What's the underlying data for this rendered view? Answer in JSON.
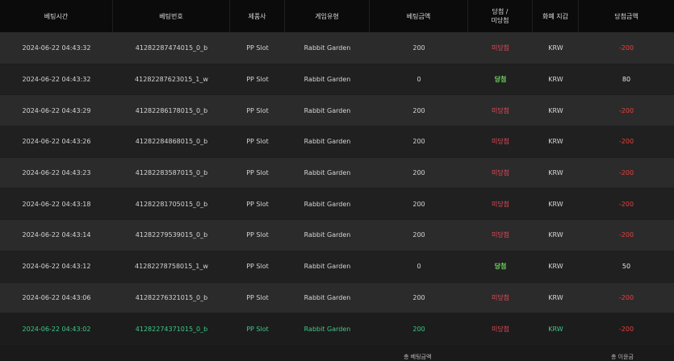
{
  "headers": [
    "베팅시간",
    "베팅번호",
    "제품사",
    "게임유형",
    "베팅금액",
    "당첨 /\n미당첨",
    "화폐 지갑",
    "당첨금액"
  ],
  "rows": [
    {
      "time": "2024-06-22 04:43:32",
      "bet_id": "41282287474015_0_b",
      "provider": "PP Slot",
      "game": "Rabbit Garden",
      "bet_amount": "200",
      "result": "미당첨",
      "currency": "KRW",
      "win_amount": "-200"
    },
    {
      "time": "2024-06-22 04:43:32",
      "bet_id": "41282287623015_1_w",
      "provider": "PP Slot",
      "game": "Rabbit Garden",
      "bet_amount": "0",
      "result": "당첨",
      "currency": "KRW",
      "win_amount": "80"
    },
    {
      "time": "2024-06-22 04:43:29",
      "bet_id": "41282286178015_0_b",
      "provider": "PP Slot",
      "game": "Rabbit Garden",
      "bet_amount": "200",
      "result": "미당첨",
      "currency": "KRW",
      "win_amount": "-200"
    },
    {
      "time": "2024-06-22 04:43:26",
      "bet_id": "41282284868015_0_b",
      "provider": "PP Slot",
      "game": "Rabbit Garden",
      "bet_amount": "200",
      "result": "미당첨",
      "currency": "KRW",
      "win_amount": "-200"
    },
    {
      "time": "2024-06-22 04:43:23",
      "bet_id": "41282283587015_0_b",
      "provider": "PP Slot",
      "game": "Rabbit Garden",
      "bet_amount": "200",
      "result": "미당첨",
      "currency": "KRW",
      "win_amount": "-200"
    },
    {
      "time": "2024-06-22 04:43:18",
      "bet_id": "41282281705015_0_b",
      "provider": "PP Slot",
      "game": "Rabbit Garden",
      "bet_amount": "200",
      "result": "미당첨",
      "currency": "KRW",
      "win_amount": "-200"
    },
    {
      "time": "2024-06-22 04:43:14",
      "bet_id": "41282279539015_0_b",
      "provider": "PP Slot",
      "game": "Rabbit Garden",
      "bet_amount": "200",
      "result": "미당첨",
      "currency": "KRW",
      "win_amount": "-200"
    },
    {
      "time": "2024-06-22 04:43:12",
      "bet_id": "41282278758015_1_w",
      "provider": "PP Slot",
      "game": "Rabbit Garden",
      "bet_amount": "0",
      "result": "당첨",
      "currency": "KRW",
      "win_amount": "50"
    },
    {
      "time": "2024-06-22 04:43:06",
      "bet_id": "41282276321015_0_b",
      "provider": "PP Slot",
      "game": "Rabbit Garden",
      "bet_amount": "200",
      "result": "미당첨",
      "currency": "KRW",
      "win_amount": "-200"
    },
    {
      "time": "2024-06-22 04:43:02",
      "bet_id": "41282274371015_0_b",
      "provider": "PP Slot",
      "game": "Rabbit Garden",
      "bet_amount": "200",
      "result": "미당첨",
      "currency": "KRW",
      "win_amount": "-200"
    }
  ],
  "footer": {
    "total_bet_label": "총 베팅금액",
    "total_win_label": "총 이윤금"
  },
  "colors": {
    "lose": "#e34b5a",
    "win": "#6cd05a",
    "negative": "#e6413e",
    "highlight_row_text": "#3ec98a"
  }
}
